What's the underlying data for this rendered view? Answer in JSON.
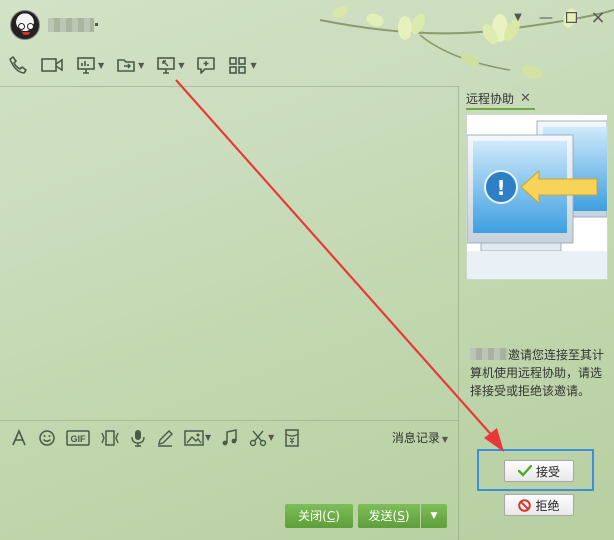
{
  "remote_panel": {
    "tab_label": "远程协助",
    "invite_text": "邀请您连接至其计算机使用远程协助，请选择接受或拒绝该邀请。",
    "accept_label": "接受",
    "reject_label": "拒绝"
  },
  "input_toolbar": {
    "gif_label": "GIF",
    "message_log_label": "消息记录"
  },
  "footer": {
    "close_label": "关闭",
    "close_key": "C",
    "send_label": "发送",
    "send_key": "S"
  },
  "colors": {
    "accent_green": "#6ea84a",
    "highlight_blue": "#3b8ee0",
    "annotation_red": "#e8383a"
  },
  "icons": {
    "toolbar": [
      "phone-icon",
      "video-icon",
      "screen-share-icon",
      "file-transfer-icon",
      "remote-desktop-icon",
      "add-chat-icon",
      "apps-icon"
    ],
    "input": [
      "font-icon",
      "emoji-icon",
      "gif-icon",
      "shake-icon",
      "voice-icon",
      "pen-icon",
      "image-icon",
      "music-icon",
      "scissors-icon",
      "red-packet-icon"
    ]
  }
}
